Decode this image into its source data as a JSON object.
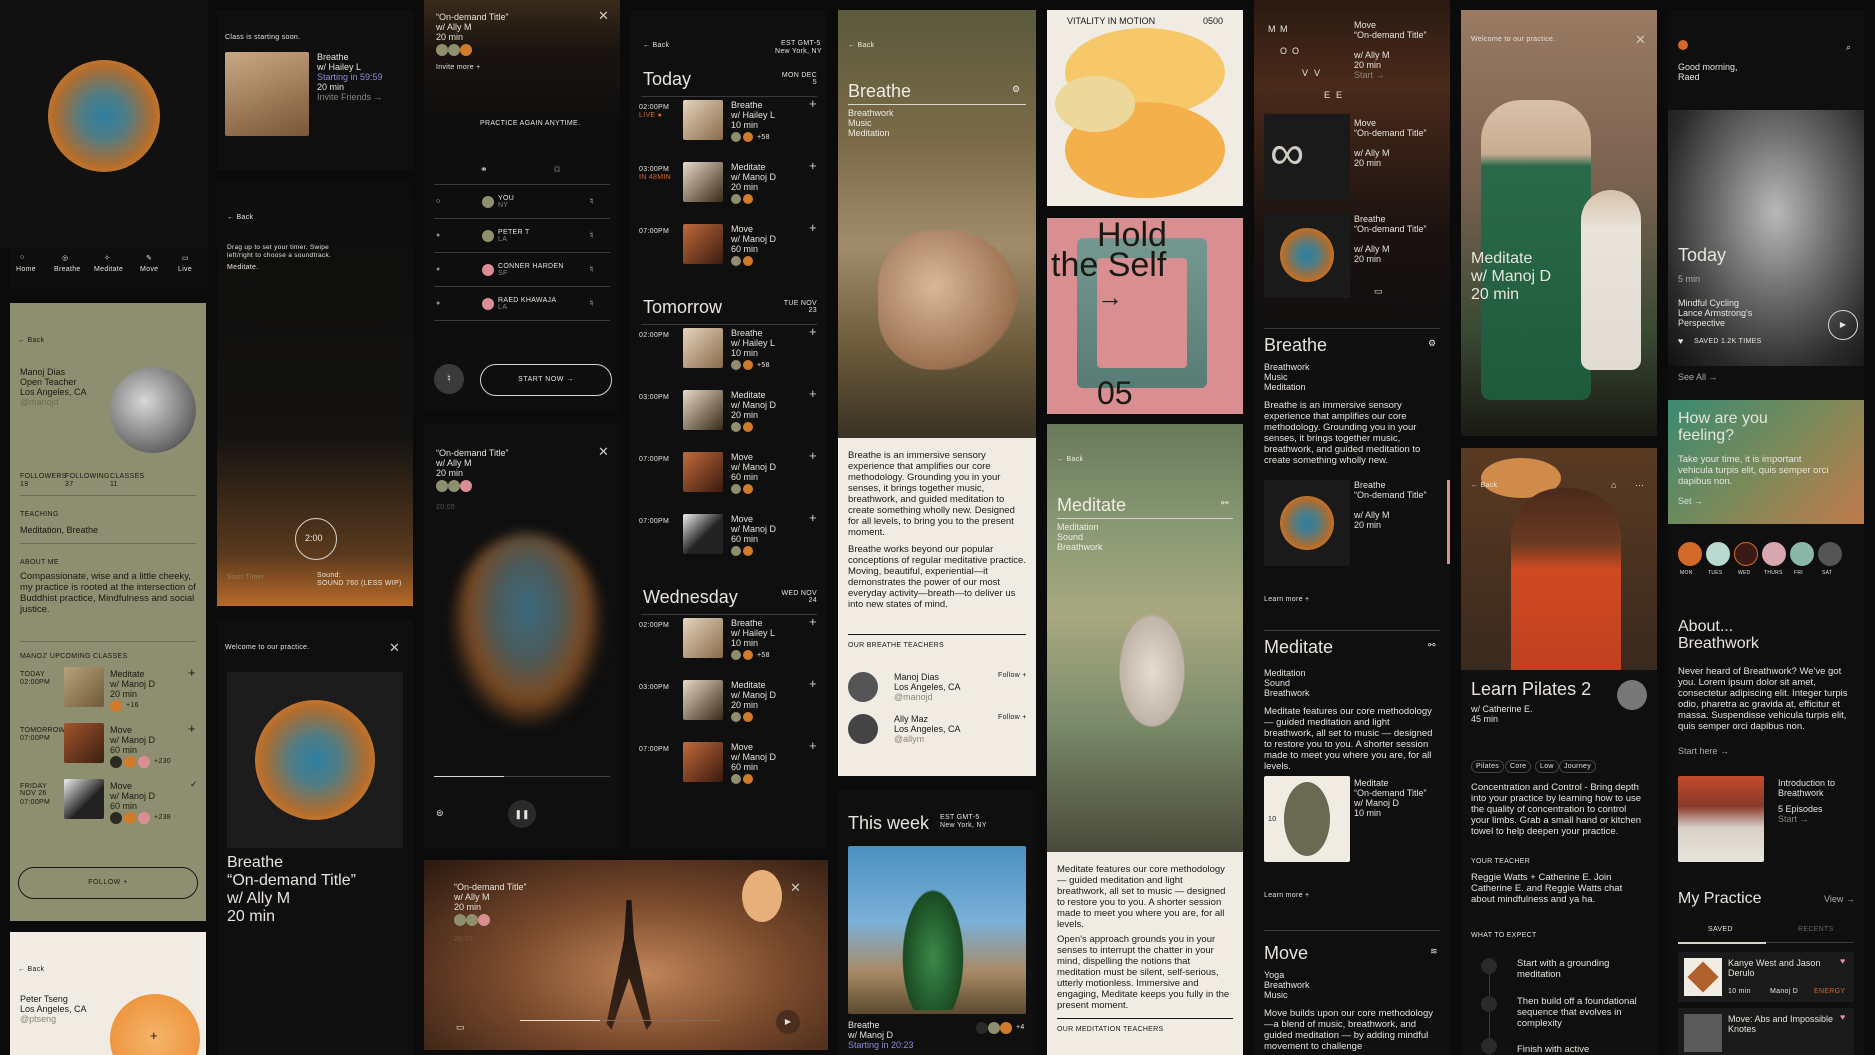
{
  "colors": {
    "accent": "#d46a2a",
    "blue": "#2e7fa0",
    "olive": "#8f8f6e",
    "pink": "#d98f92",
    "yellow": "#f7c86a",
    "cream": "#f0ece3"
  },
  "tabs": {
    "items": [
      "Home",
      "Breathe",
      "Meditate",
      "Move",
      "Live"
    ]
  },
  "profile_manoj": {
    "back": "← Back",
    "name": "Manoj Dias",
    "role": "Open Teacher",
    "location": "Los Angeles, CA",
    "handle": "@manojd",
    "followers_label": "FOLLOWERS",
    "followers": "19",
    "following_label": "FOLLOWING",
    "following": "37",
    "classes_label": "CLASSES",
    "classes": "11",
    "teaching_label": "TEACHING",
    "teaching": "Meditation, Breathe",
    "about_label": "ABOUT ME",
    "about": "Compassionate, wise and a little cheeky, my practice is rooted at the intersection of Buddhist practice, Mindfulness and social justice.",
    "upcoming_label": "MANOJ' UPCOMING CLASSES",
    "classes_list": [
      {
        "day": "TODAY",
        "time": "02:00PM",
        "title": "Meditate",
        "teacher": "w/ Manoj D",
        "duration": "20 min",
        "count": "+16"
      },
      {
        "day": "TOMORROW",
        "time": "07:00PM",
        "title": "Move",
        "teacher": "w/ Manoj D",
        "duration": "60 min",
        "count": "+230"
      },
      {
        "day": "FRIDAY NOV 26",
        "time": "07:00PM",
        "title": "Move",
        "teacher": "w/ Manoj D",
        "duration": "60 min",
        "count": "+238"
      }
    ],
    "follow": "FOLLOW +"
  },
  "profile_peter": {
    "back": "← Back",
    "name": "Peter Tseng",
    "location": "Los Angeles, CA",
    "handle": "@ptseng"
  },
  "starting": {
    "label": "Class is starting soon.",
    "title": "Breathe",
    "teacher": "w/ Hailey L",
    "starting": "Starting in 59:59",
    "duration": "20 min",
    "invite": "Invite Friends →"
  },
  "timer": {
    "back": "← Back",
    "hint": "Drag up to set your timer. Swipe left/right to choose a soundtrack.",
    "mode": "Meditate.",
    "time": "2:00",
    "start": "Start Timer",
    "sound_label": "Sound:",
    "sound": "SOUND 760 (LESS WIP)"
  },
  "welcome_ally": {
    "label": "Welcome to our practice.",
    "line1": "Breathe",
    "line2": "“On-demand Title”",
    "line3": "w/ Ally M",
    "line4": "20 min"
  },
  "practice": {
    "title": "“On-demand Title”",
    "teacher": "w/ Ally M",
    "duration": "20 min",
    "invite": "Invite more +",
    "again": "PRACTICE AGAIN ANYTIME.",
    "people": [
      {
        "name": "YOU",
        "loc": "NY"
      },
      {
        "name": "PETER T",
        "loc": "LA"
      },
      {
        "name": "CONNER HARDEN",
        "loc": "SF"
      },
      {
        "name": "RAED KHAWAJA",
        "loc": "LA"
      }
    ],
    "start": "START NOW →"
  },
  "player": {
    "title": "“On-demand Title”",
    "teacher": "w/ Ally M",
    "duration": "20 min",
    "elapsed": "20:05"
  },
  "video": {
    "title": "“On-demand Title”",
    "teacher": "w/ Ally M",
    "duration": "20 min",
    "elapsed": "20:05"
  },
  "schedule": {
    "back": "← Back",
    "tz": "EST GMT-5",
    "city": "New York, NY",
    "days": [
      {
        "name": "Today",
        "date": "MON DEC 5",
        "rows": [
          {
            "time": "02:00PM",
            "live": "LIVE ●",
            "title": "Breathe",
            "teacher": "w/ Hailey L",
            "dur": "10 min",
            "count": "+58"
          },
          {
            "time": "03:00PM",
            "live": "IN 48MIN",
            "title": "Meditate",
            "teacher": "w/ Manoj D",
            "dur": "20 min"
          },
          {
            "time": "07:00PM",
            "title": "Move",
            "teacher": "w/ Manoj D",
            "dur": "60 min"
          }
        ]
      },
      {
        "name": "Tomorrow",
        "date": "TUE NOV 23",
        "rows": [
          {
            "time": "02:00PM",
            "title": "Breathe",
            "teacher": "w/ Hailey L",
            "dur": "10 min",
            "count": "+58"
          },
          {
            "time": "03:00PM",
            "title": "Meditate",
            "teacher": "w/ Manoj D",
            "dur": "20 min"
          },
          {
            "time": "07:00PM",
            "title": "Move",
            "teacher": "w/ Manoj D",
            "dur": "60 min"
          },
          {
            "time": "07:00PM",
            "title": "Move",
            "teacher": "w/ Manoj D",
            "dur": "60 min"
          }
        ]
      },
      {
        "name": "Wednesday",
        "date": "WED NOV 24",
        "rows": [
          {
            "time": "02:00PM",
            "title": "Breathe",
            "teacher": "w/ Hailey L",
            "dur": "10 min",
            "count": "+58"
          },
          {
            "time": "03:00PM",
            "title": "Meditate",
            "teacher": "w/ Manoj D",
            "dur": "20 min"
          },
          {
            "time": "07:00PM",
            "title": "Move",
            "teacher": "w/ Manoj D",
            "dur": "60 min"
          }
        ]
      }
    ]
  },
  "breathe_article": {
    "back": "← Back",
    "title": "Breathe",
    "tags": [
      "Breathwork",
      "Music",
      "Meditation"
    ],
    "p1": "Breathe is an immersive sensory experience that amplifies our core methodology. Grounding you in your senses, it brings together music, breathwork, and guided meditation to create something wholly new. Designed for all levels, to bring you to the present moment.",
    "p2": "Breathe works beyond our popular conceptions of regular meditative practice. Moving, beautiful, experiential—it demonstrates the power of our most everyday activity—breath—to deliver us into new states of mind.",
    "teachers_label": "OUR BREATHE TEACHERS",
    "teachers": [
      {
        "name": "Manoj Dias",
        "loc": "Los Angeles, CA",
        "handle": "@manojd",
        "follow": "Follow +"
      },
      {
        "name": "Ally Maz",
        "loc": "Los Angeles, CA",
        "handle": "@allym",
        "follow": "Follow +"
      }
    ]
  },
  "this_week": {
    "title": "This week",
    "tz": "EST GMT-5",
    "city": "New York, NY",
    "card_title": "Breathe",
    "card_teacher": "w/ Manoj D",
    "card_start": "Starting in 20:23",
    "count": "+4"
  },
  "poster1": {
    "title": "VITALITY IN MOTION",
    "num": "0500"
  },
  "poster2": {
    "title1": "Hold",
    "title2": "the Self",
    "arrow": "→",
    "num": "05"
  },
  "meditate_article": {
    "back": "← Back",
    "title": "Meditate",
    "tags": [
      "Meditation",
      "Sound",
      "Breathwork"
    ],
    "p1": "Meditate features our core methodology — guided meditation and light breathwork, all set to music — designed to restore you to you. A shorter session made to meet you where you are, for all levels.",
    "p2": "Open's approach grounds you in your senses to interrupt the chatter in your mind, dispelling the notions that meditation must be silent, self-serious, utterly motionless. Immersive and engaging, Meditate keeps you fully in the present moment.",
    "teachers_label": "OUR MEDITATION TEACHERS"
  },
  "categories": {
    "letters": [
      "M",
      "M",
      "O",
      "O",
      "V",
      "V",
      "E",
      "E"
    ],
    "cards": [
      {
        "title": "Move",
        "sub": "“On-demand Title”",
        "teacher": "w/ Ally M",
        "dur": "20 min",
        "start": "Start →"
      },
      {
        "title": "Move",
        "sub": "“On-demand Title”",
        "teacher": "w/ Ally M",
        "dur": "20 min"
      },
      {
        "title": "Breathe",
        "sub": "“On-demand Title”",
        "teacher": "w/ Ally M",
        "dur": "20 min"
      }
    ],
    "breathe": {
      "title": "Breathe",
      "tags": [
        "Breathwork",
        "Music",
        "Meditation"
      ],
      "desc": "Breathe is an immersive sensory experience that amplifies our core methodology. Grounding you in your senses, it brings together music, breathwork, and guided meditation to create something wholly new.",
      "card": {
        "title": "Breathe",
        "sub": "“On-demand Title”",
        "teacher": "w/ Ally M",
        "dur": "20 min"
      },
      "learn": "Learn more +"
    },
    "meditate": {
      "title": "Meditate",
      "tags": [
        "Meditation",
        "Sound",
        "Breathwork"
      ],
      "desc": "Meditate features our core methodology — guided meditation and light breathwork, all set to music — designed to restore you to you. A shorter session made to meet you where you are, for all levels.",
      "card": {
        "title": "Meditate",
        "sub": "“On-demand Title”",
        "teacher": "w/ Manoj D",
        "dur": "10 min",
        "num": "10"
      },
      "learn": "Learn more +"
    },
    "move": {
      "title": "Move",
      "tags": [
        "Yoga",
        "Breathwork",
        "Music"
      ],
      "desc": "Move builds upon our core methodology—a blend of music, breathwork, and guided meditation — by adding mindful movement to challenge"
    }
  },
  "welcome_manoj": {
    "label": "Welcome to our practice.",
    "line1": "Meditate",
    "line2": "w/ Manoj D",
    "line3": "20 min"
  },
  "pilates": {
    "back": "← Back",
    "title": "Learn Pilates 2",
    "teacher": "w/ Catherine E.",
    "dur": "45 min",
    "chips": [
      "Pilates",
      "Core",
      "Low",
      "Journey"
    ],
    "desc": "Concentration and Control - Bring depth into your practice by learning how to use the quality of concentration to control your limbs. Grab a small hand or kitchen towel to help deepen your practice.",
    "teacher_label": "YOUR TEACHER",
    "teacher_text": "Reggie Watts + Catherine E. Join Catherine E. and Reggie Watts chat about mindfulness and ya ha.",
    "expect_label": "WHAT TO EXPECT",
    "steps": [
      "Start with a grounding meditation",
      "Then build off a foundational sequence that evolves in complexity",
      "Finish with active breathwork"
    ]
  },
  "home": {
    "greeting": "Good morning,",
    "name": "Raed",
    "today": "Today",
    "dur": "5 min",
    "show1": "Mindful Cycling",
    "show2": "Lance Armstrong's",
    "show3": "Perspective",
    "saved": "SAVED 1.2K TIMES",
    "see_all": "See All →",
    "feeling_title": "How are you feeling?",
    "feeling_text": "Take your time, it is important vehicula turpis elit, quis semper orci dapibus non.",
    "set": "Set →",
    "days": [
      "MON",
      "TUES",
      "WED",
      "THURS",
      "FRI",
      "SAT"
    ],
    "about_title": "About... Breathwork",
    "about_text": "Never heard of Breathwork? We've got you. Lorem ipsum dolor sit amet, consectetur adipiscing elit. Integer turpis odio, pharetra ac gravida at, efficitur et massa. Suspendisse vehicula turpis elit, quis semper orci dapibus non.",
    "start_here": "Start here →",
    "intro_title": "Introduction to Breathwork",
    "intro_eps": "5 Episodes",
    "intro_start": "Start →",
    "practice_title": "My Practice",
    "view": "View →",
    "tab_saved": "SAVED",
    "tab_recents": "RECENTS",
    "items": [
      {
        "title": "Kanye West and Jason Derulo",
        "dur": "10 min",
        "teacher": "Manoj D",
        "tag": "ENERGY"
      },
      {
        "title": "Move: Abs and Impossible Knotes"
      }
    ]
  }
}
